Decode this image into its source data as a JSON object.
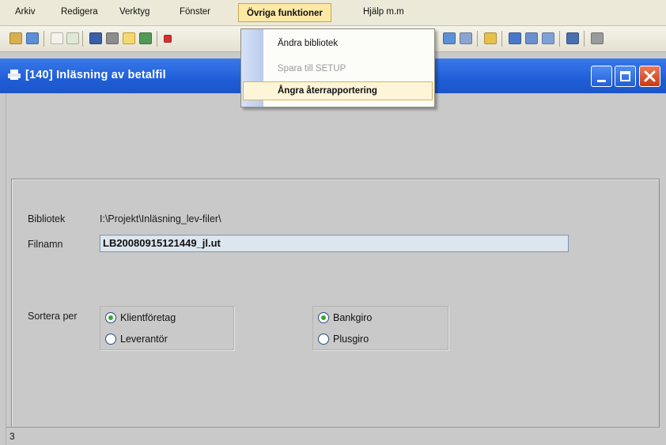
{
  "menubar": {
    "items": [
      "Arkiv",
      "Redigera",
      "Verktyg",
      "Fönster",
      "Övriga funktioner",
      "Hjälp m.m"
    ]
  },
  "dropdown": {
    "items": [
      {
        "label": "Ändra bibliotek",
        "enabled": true
      },
      {
        "label": "Spara till SETUP",
        "enabled": false
      },
      {
        "label": "Ångra återrapportering",
        "enabled": true,
        "highlighted": true
      }
    ]
  },
  "window": {
    "title": "[140]  Inläsning av betalfil"
  },
  "form": {
    "bibliotek_label": "Bibliotek",
    "bibliotek_value": "I:\\Projekt\\Inläsning_lev-filer\\",
    "filnamn_label": "Filnamn",
    "filnamn_value": "LB20080915121449_jl.ut",
    "sortera_label": "Sortera per",
    "group1": [
      {
        "label": "Klientföretag",
        "checked": true
      },
      {
        "label": "Leverantör",
        "checked": false
      }
    ],
    "group2": [
      {
        "label": "Bankgiro",
        "checked": true
      },
      {
        "label": "Plusgiro",
        "checked": false
      }
    ]
  },
  "status": {
    "text": "3"
  },
  "colors": {
    "titlebar": "#1f5ed8",
    "menu_highlight": "#fde9a6",
    "radio_dot": "#3aa33a"
  }
}
